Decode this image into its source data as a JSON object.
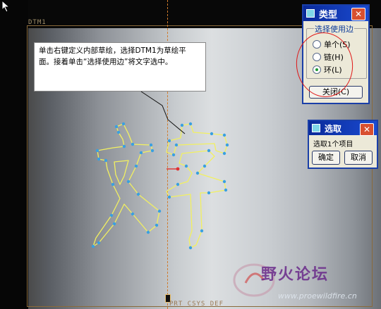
{
  "viewport": {
    "datum_label": "DTM1",
    "csys_label": "PRT_CSYS_DEF"
  },
  "instruction_note": {
    "line1": "单击右键定义内部草绘，选择DTM1为草绘平",
    "line2": "面。接着单击“选择使用边”将文字选中。"
  },
  "type_dialog": {
    "title": "类型",
    "group_label": "选择使用边",
    "options": [
      {
        "label": "单个(S)",
        "selected": false
      },
      {
        "label": "链(H)",
        "selected": false
      },
      {
        "label": "环(L)",
        "selected": true
      }
    ],
    "close_label": "关闭(C)",
    "highlight_color": "#e01818"
  },
  "select_dialog": {
    "title": "选取",
    "status": "选取1个项目",
    "ok_label": "确定",
    "cancel_label": "取消"
  },
  "watermark": {
    "title": "野火论坛",
    "url": "www.proewildfire.cn"
  },
  "colors": {
    "sketch_line": "#f2f060",
    "sketch_vertex": "#3aa0e0",
    "axis": "#d07a2a",
    "title_bar": "#1a4ad0"
  },
  "icons": [
    "arrow-cursor-icon",
    "window-icon",
    "close-icon",
    "radio-icon",
    "watermark-logo-icon"
  ]
}
